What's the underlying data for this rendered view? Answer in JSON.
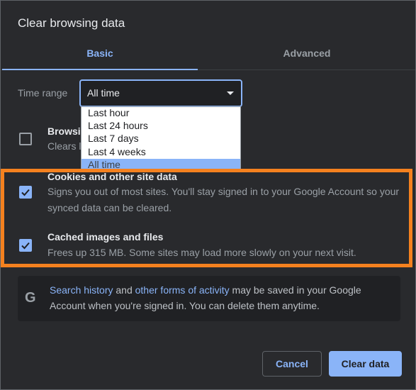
{
  "dialog": {
    "title": "Clear browsing data"
  },
  "tabs": [
    {
      "label": "Basic",
      "selected": true
    },
    {
      "label": "Advanced",
      "selected": false
    }
  ],
  "time_range": {
    "label": "Time range",
    "value": "All time",
    "options": [
      "Last hour",
      "Last 24 hours",
      "Last 7 days",
      "Last 4 weeks",
      "All time"
    ]
  },
  "items": [
    {
      "title": "Browsing history",
      "visible_title": "Browsi",
      "desc_visible": "Clears l",
      "checked": false
    },
    {
      "title": "Cookies and other site data",
      "desc": "Signs you out of most sites. You'll stay signed in to your Google Account so your synced data can be cleared.",
      "checked": true
    },
    {
      "title": "Cached images and files",
      "desc": "Frees up 315 MB. Some sites may load more slowly on your next visit.",
      "checked": true
    }
  ],
  "info": {
    "icon": "google-g-icon",
    "link1": "Search history",
    "and": " and ",
    "link2": "other forms of activity",
    "rest": " may be saved in your Google Account when you're signed in. You can delete them anytime."
  },
  "buttons": {
    "cancel": "Cancel",
    "clear": "Clear data"
  },
  "colors": {
    "accent": "#8ab4f8",
    "highlight": "#f4811f",
    "background": "#292a2d"
  }
}
